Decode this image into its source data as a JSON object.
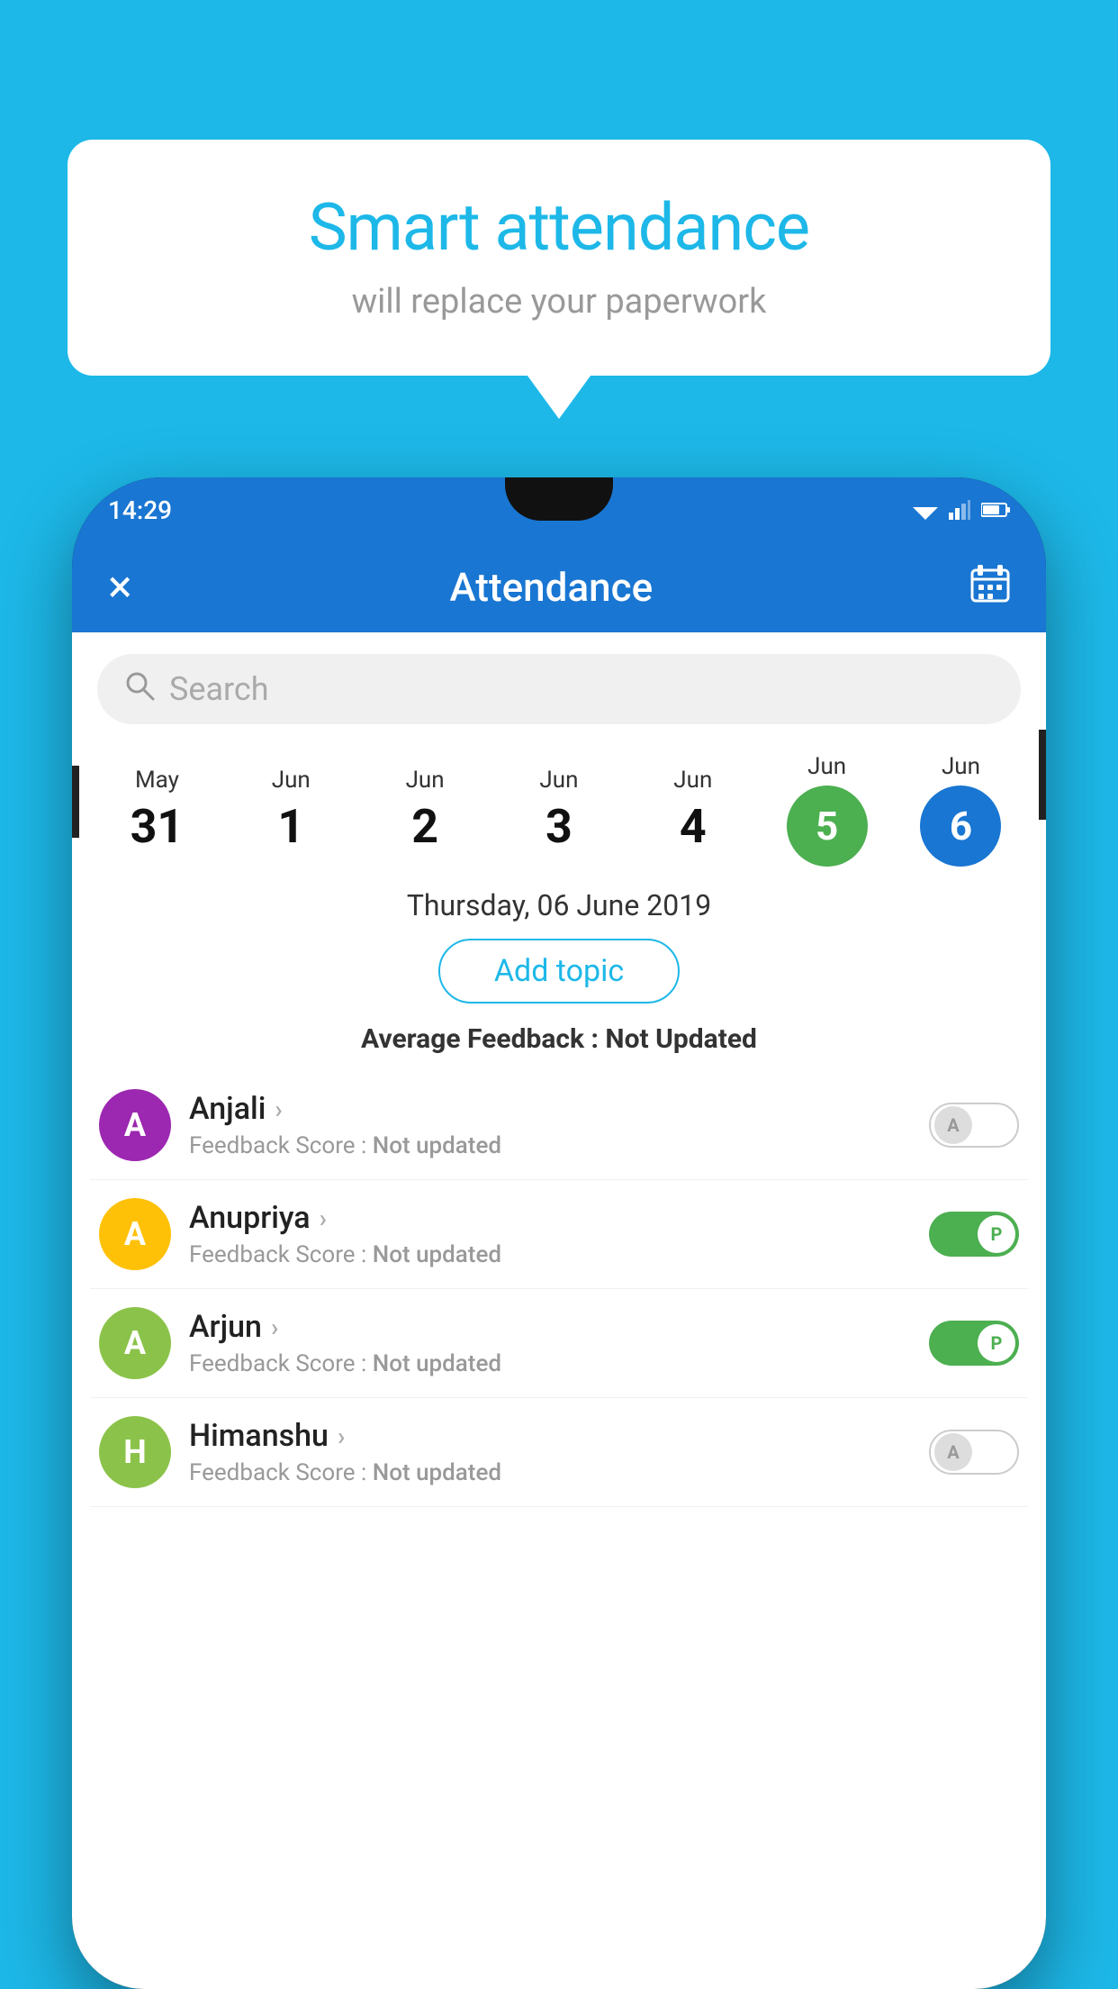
{
  "background_color": "#1DB8E8",
  "bubble": {
    "title": "Smart attendance",
    "subtitle": "will replace your paperwork"
  },
  "status_bar": {
    "time": "14:29"
  },
  "header": {
    "title": "Attendance",
    "close_label": "×",
    "calendar_label": "📅"
  },
  "search": {
    "placeholder": "Search"
  },
  "dates": [
    {
      "month": "May",
      "day": "31",
      "style": "normal"
    },
    {
      "month": "Jun",
      "day": "1",
      "style": "normal"
    },
    {
      "month": "Jun",
      "day": "2",
      "style": "normal"
    },
    {
      "month": "Jun",
      "day": "3",
      "style": "normal"
    },
    {
      "month": "Jun",
      "day": "4",
      "style": "normal"
    },
    {
      "month": "Jun",
      "day": "5",
      "style": "green"
    },
    {
      "month": "Jun",
      "day": "6",
      "style": "blue"
    }
  ],
  "selected_date": "Thursday, 06 June 2019",
  "add_topic_label": "Add topic",
  "avg_feedback_label": "Average Feedback :",
  "avg_feedback_value": "Not Updated",
  "students": [
    {
      "name": "Anjali",
      "avatar_letter": "A",
      "avatar_color": "#9C27B0",
      "feedback_label": "Feedback Score :",
      "feedback_value": "Not updated",
      "toggle": "absent",
      "toggle_letter": "A"
    },
    {
      "name": "Anupriya",
      "avatar_letter": "A",
      "avatar_color": "#FFC107",
      "feedback_label": "Feedback Score :",
      "feedback_value": "Not updated",
      "toggle": "present",
      "toggle_letter": "P"
    },
    {
      "name": "Arjun",
      "avatar_letter": "A",
      "avatar_color": "#8BC34A",
      "feedback_label": "Feedback Score :",
      "feedback_value": "Not updated",
      "toggle": "present",
      "toggle_letter": "P"
    },
    {
      "name": "Himanshu",
      "avatar_letter": "H",
      "avatar_color": "#8BC34A",
      "feedback_label": "Feedback Score :",
      "feedback_value": "Not updated",
      "toggle": "absent",
      "toggle_letter": "A"
    }
  ]
}
